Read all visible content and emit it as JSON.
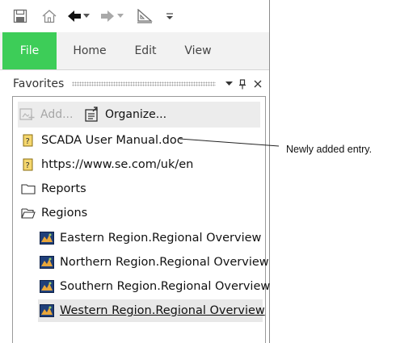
{
  "ribbon": {
    "tabs": [
      {
        "label": "File",
        "active": true
      },
      {
        "label": "Home"
      },
      {
        "label": "Edit"
      },
      {
        "label": "View"
      }
    ],
    "accent_color": "#3dcd58"
  },
  "favorites": {
    "title": "Favorites",
    "toolbar": {
      "add_label": "Add...",
      "organize_label": "Organize..."
    },
    "items": [
      {
        "label": "SCADA User Manual.doc",
        "icon": "favorite-link-icon"
      },
      {
        "label": "https://www.se.com/uk/en",
        "icon": "favorite-link-icon"
      },
      {
        "label": "Reports",
        "icon": "folder-closed-icon"
      },
      {
        "label": "Regions",
        "icon": "folder-open-icon",
        "children": [
          {
            "label": "Eastern Region.Regional Overview",
            "icon": "graphics-page-icon"
          },
          {
            "label": "Northern Region.Regional Overview",
            "icon": "graphics-page-icon"
          },
          {
            "label": "Southern Region.Regional Overview",
            "icon": "graphics-page-icon"
          },
          {
            "label": "Western Region.Regional Overview",
            "icon": "graphics-page-icon",
            "selected": true
          }
        ]
      }
    ]
  },
  "callout": {
    "text": "Newly added entry."
  }
}
